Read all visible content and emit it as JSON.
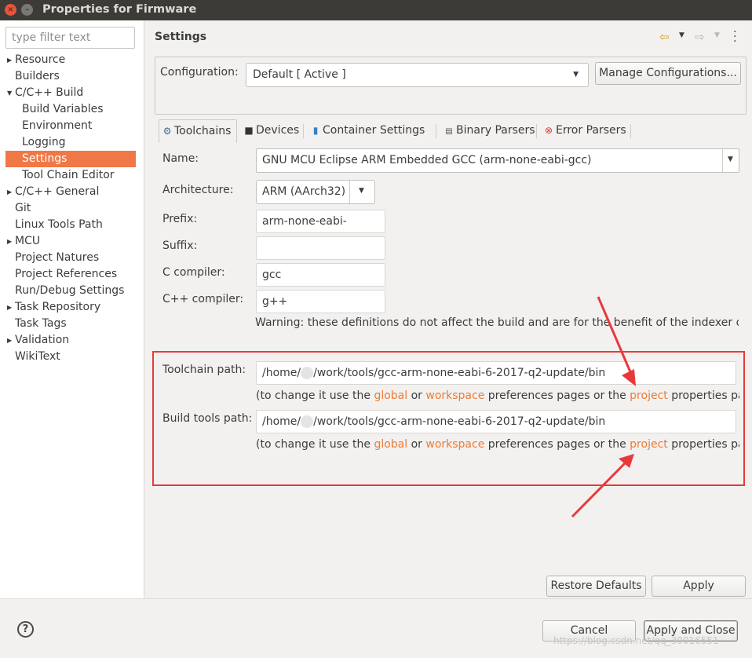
{
  "window": {
    "title": "Properties for Firmware",
    "close_glyph": "×",
    "minimize_glyph": "–"
  },
  "sidebar": {
    "filter_placeholder": "type filter text",
    "items": [
      {
        "label": "Resource",
        "level": 0,
        "expandable": true
      },
      {
        "label": "Builders",
        "level": 0,
        "expandable": false
      },
      {
        "label": "C/C++ Build",
        "level": 0,
        "expandable": true,
        "expanded": true
      },
      {
        "label": "Build Variables",
        "level": 1
      },
      {
        "label": "Environment",
        "level": 1
      },
      {
        "label": "Logging",
        "level": 1
      },
      {
        "label": "Settings",
        "level": 1,
        "selected": true
      },
      {
        "label": "Tool Chain Editor",
        "level": 1
      },
      {
        "label": "C/C++ General",
        "level": 0,
        "expandable": true
      },
      {
        "label": "Git",
        "level": 0
      },
      {
        "label": "Linux Tools Path",
        "level": 0
      },
      {
        "label": "MCU",
        "level": 0,
        "expandable": true
      },
      {
        "label": "Project Natures",
        "level": 0
      },
      {
        "label": "Project References",
        "level": 0
      },
      {
        "label": "Run/Debug Settings",
        "level": 0
      },
      {
        "label": "Task Repository",
        "level": 0,
        "expandable": true
      },
      {
        "label": "Task Tags",
        "level": 0
      },
      {
        "label": "Validation",
        "level": 0,
        "expandable": true
      },
      {
        "label": "WikiText",
        "level": 0
      }
    ]
  },
  "page": {
    "header": "Settings",
    "configuration_label": "Configuration:",
    "configuration_value": "Default  [ Active ]",
    "manage_button": "Manage Configurations...",
    "tabs": [
      {
        "label": "Toolchains",
        "icon": "toolchain-icon",
        "active": true
      },
      {
        "label": "Devices",
        "icon": "chip-icon"
      },
      {
        "label": "Container Settings",
        "icon": "container-icon"
      },
      {
        "label": "Binary Parsers",
        "icon": "binary-icon"
      },
      {
        "label": "Error Parsers",
        "icon": "error-icon"
      }
    ],
    "form": {
      "name_label": "Name:",
      "name_value": "GNU MCU Eclipse ARM Embedded GCC (arm-none-eabi-gcc)",
      "architecture_label": "Architecture:",
      "architecture_value": "ARM (AArch32)",
      "prefix_label": "Prefix:",
      "prefix_value": "arm-none-eabi-",
      "suffix_label": "Suffix:",
      "suffix_value": "",
      "c_compiler_label": "C compiler:",
      "c_compiler_value": "gcc",
      "cpp_compiler_label": "C++ compiler:",
      "cpp_compiler_value": "g++",
      "warning": "Warning: these definitions do not affect the build and are for the benefit of the indexer on",
      "toolchain_path_label": "Toolchain path:",
      "toolchain_path_prefix": "/home/",
      "toolchain_path_suffix": "/work/tools/gcc-arm-none-eabi-6-2017-q2-update/bin",
      "build_tools_path_label": "Build tools path:",
      "build_tools_path_prefix": "/home/",
      "build_tools_path_suffix": "/work/tools/gcc-arm-none-eabi-6-2017-q2-update/bin",
      "note": {
        "prefix": "(to change it use the ",
        "global": "global",
        "or": " or ",
        "workspace": "workspace",
        "middle": " preferences pages or the ",
        "project": "project",
        "suffix": " properties page"
      }
    },
    "restore_defaults_button": "Restore Defaults",
    "apply_button": "Apply"
  },
  "footer": {
    "help_glyph": "?",
    "cancel_button": "Cancel",
    "apply_close_button": "Apply and Close",
    "watermark": "https://blog.csdn.net/qq_30016551"
  },
  "colors": {
    "selection": "#f07746",
    "link": "#ee7b35",
    "annotation": "#e8393a",
    "titlebar": "#3c3b37"
  }
}
